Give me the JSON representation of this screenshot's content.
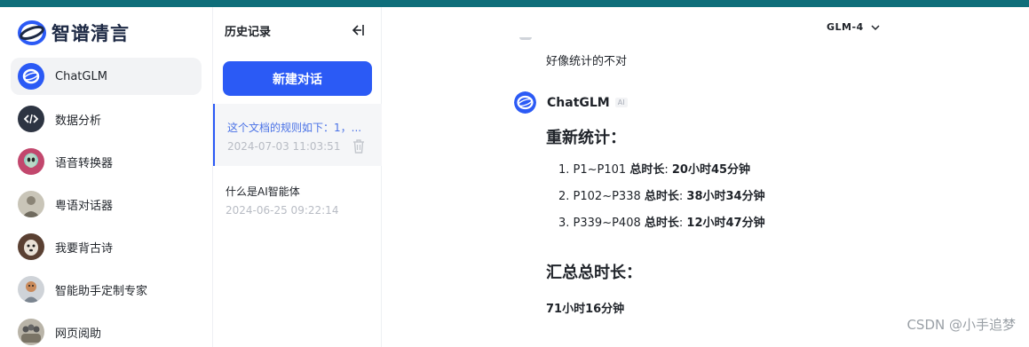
{
  "brand": {
    "name": "智谱清言"
  },
  "agents": [
    {
      "label": "ChatGLM",
      "icon": "chatglm-logo-icon",
      "active": true
    },
    {
      "label": "数据分析",
      "icon": "code-icon"
    },
    {
      "label": "语音转换器",
      "icon": "alien-avatar-icon"
    },
    {
      "label": "粤语对话器",
      "icon": "person-avatar-icon"
    },
    {
      "label": "我要背古诗",
      "icon": "dog-avatar-icon"
    },
    {
      "label": "智能助手定制专家",
      "icon": "robot-avatar-icon"
    },
    {
      "label": "网页阅助",
      "icon": "group-avatar-icon"
    }
  ],
  "history": {
    "title": "历史记录",
    "new_chat_label": "新建对话",
    "items": [
      {
        "title": "这个文档的规则如下：1，...",
        "date": "2024-07-03 11:03:51",
        "active": true
      },
      {
        "title": "什么是AI智能体",
        "date": "2024-06-25 09:22:14"
      }
    ]
  },
  "model": {
    "label": "GLM-4"
  },
  "chat": {
    "user_message": "好像统计的不对",
    "bot_name": "ChatGLM",
    "ai_tag": "AI",
    "heading1": "重新统计：",
    "items": [
      {
        "num": "1.",
        "range": "P1~P101",
        "label": "总时长",
        "value": "20小时45分钟"
      },
      {
        "num": "2.",
        "range": "P102~P338",
        "label": "总时长",
        "value": "38小时34分钟"
      },
      {
        "num": "3.",
        "range": "P339~P408",
        "label": "总时长",
        "value": "12小时47分钟"
      }
    ],
    "heading2": "汇总总时长：",
    "total": "71小时16分钟"
  },
  "watermark": "CSDN @小手追梦",
  "colors": {
    "accent": "#2b5af5",
    "topbar": "#0f6e7a"
  }
}
